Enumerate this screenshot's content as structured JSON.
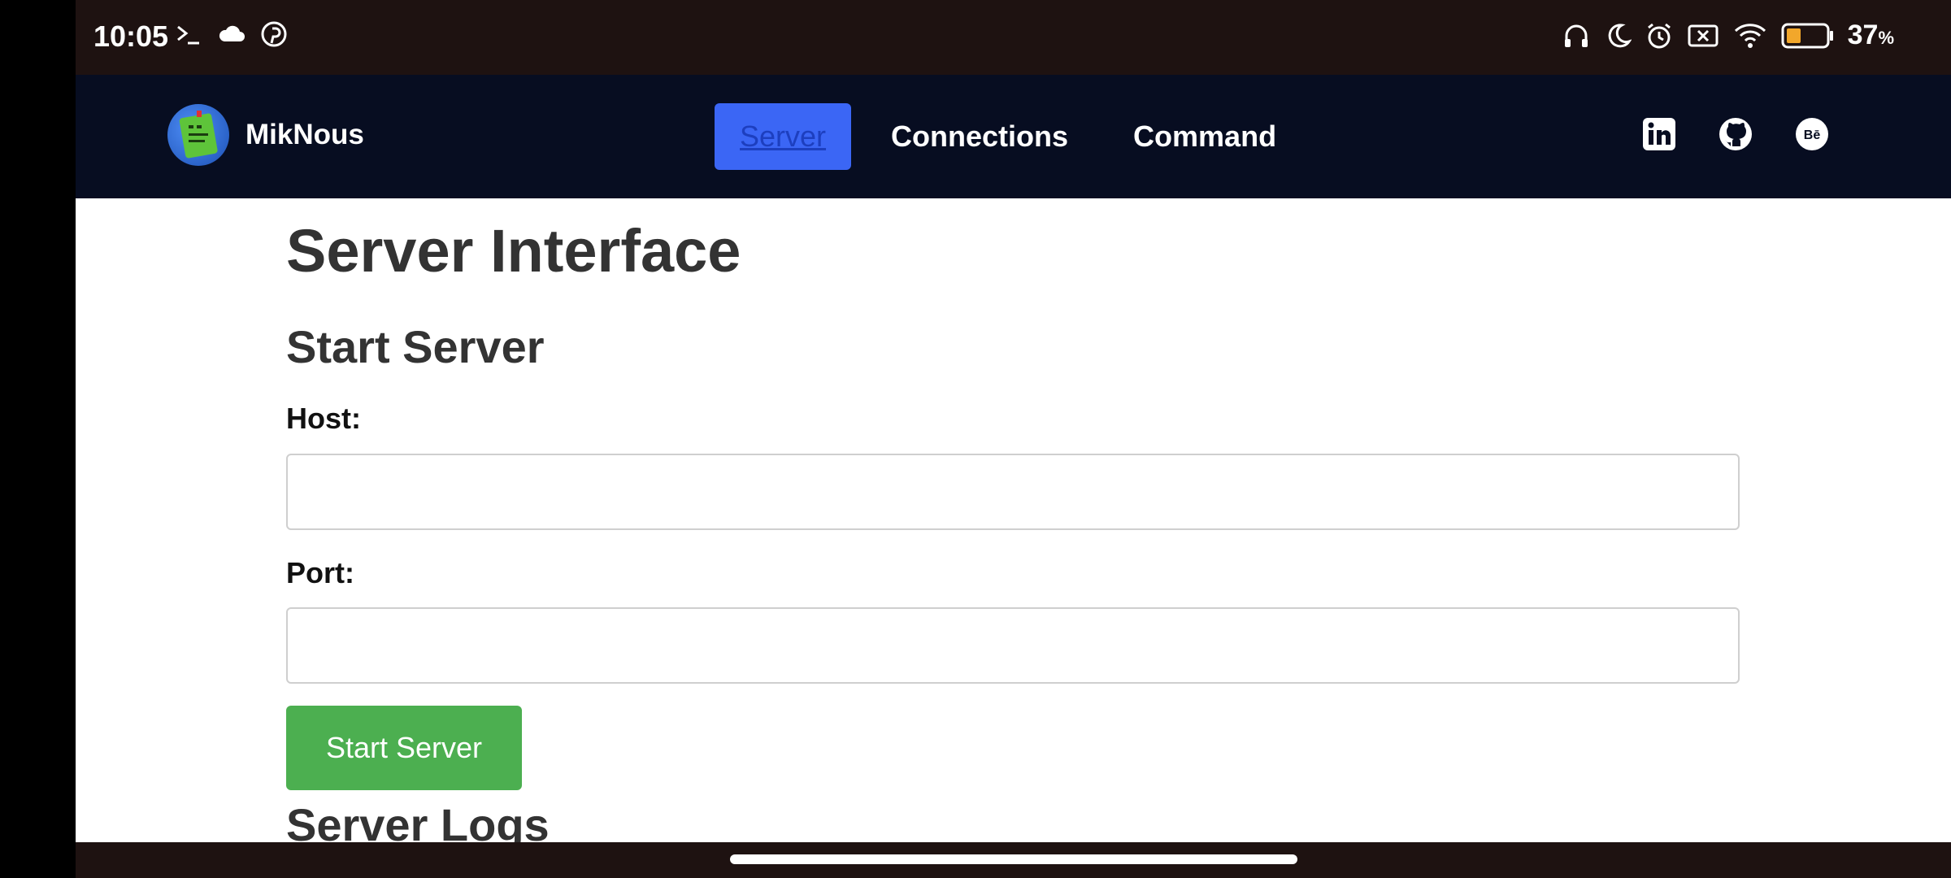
{
  "status_bar": {
    "time": "10:05",
    "battery_percent": "37",
    "battery_unit": "%",
    "left_icons": [
      "terminal-icon",
      "cloud-icon",
      "pinterest-icon"
    ],
    "right_icons": [
      "headphones-icon",
      "moon-icon",
      "alarm-icon",
      "no-sim-icon",
      "wifi-icon",
      "battery-icon"
    ]
  },
  "navbar": {
    "brand_name": "MikNous",
    "links": [
      {
        "label": "Server",
        "active": true
      },
      {
        "label": "Connections",
        "active": false
      },
      {
        "label": "Command",
        "active": false
      }
    ],
    "social": [
      "linkedin-icon",
      "github-icon",
      "behance-icon"
    ]
  },
  "main": {
    "page_title": "Server Interface",
    "section_title": "Start Server",
    "host_label": "Host:",
    "host_value": "",
    "port_label": "Port:",
    "port_value": "",
    "start_button": "Start Server",
    "logs_title": "Server Logs"
  },
  "colors": {
    "navbar_bg": "#070d21",
    "active_link_bg": "#3b66f5",
    "start_button_bg": "#4caf50",
    "status_bar_bg": "#1e1211"
  }
}
